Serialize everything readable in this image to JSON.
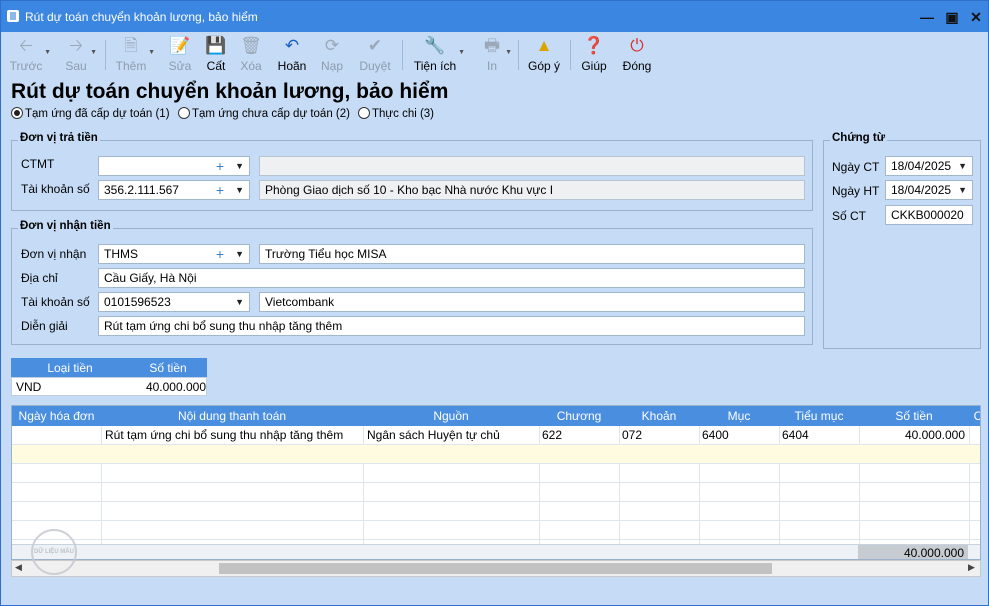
{
  "window": {
    "title": "Rút dự toán chuyển khoản lương, bảo hiểm"
  },
  "toolbar": {
    "items": [
      {
        "label": "Trước",
        "icon": "arrow-left-icon",
        "enabled": false
      },
      {
        "label": "Sau",
        "icon": "arrow-right-icon",
        "enabled": false
      },
      {
        "label": "Thêm",
        "icon": "new-document-icon",
        "enabled": false
      },
      {
        "label": "Sửa",
        "icon": "edit-document-icon",
        "enabled": false
      },
      {
        "label": "Cất",
        "icon": "save-icon",
        "enabled": true
      },
      {
        "label": "Xóa",
        "icon": "delete-document-icon",
        "enabled": false
      },
      {
        "label": "Hoãn",
        "icon": "undo-icon",
        "enabled": true
      },
      {
        "label": "Nạp",
        "icon": "refresh-icon",
        "enabled": false
      },
      {
        "label": "Duyệt",
        "icon": "checkmark-icon",
        "enabled": false
      },
      {
        "label": "Tiện ích",
        "icon": "tools-icon",
        "enabled": true
      },
      {
        "label": "In",
        "icon": "printer-icon",
        "enabled": false
      },
      {
        "label": "Góp ý",
        "icon": "feedback-icon",
        "enabled": true
      },
      {
        "label": "Giúp",
        "icon": "help-icon",
        "enabled": true
      },
      {
        "label": "Đóng",
        "icon": "power-icon",
        "enabled": true
      }
    ]
  },
  "page": {
    "heading": "Rút dự toán chuyển khoản lương, bảo hiểm"
  },
  "radio_options": [
    {
      "label": "Tạm ứng đã cấp dự toán (1)",
      "selected": true
    },
    {
      "label": "Tạm ứng chưa cấp dự toán (2)",
      "selected": false
    },
    {
      "label": "Thực chi (3)",
      "selected": false
    }
  ],
  "payer": {
    "legend": "Đơn vị trả tiền",
    "ctmt_label": "CTMT",
    "ctmt_value": "",
    "ctmt_desc": "",
    "account_label": "Tài khoản số",
    "account_value": "356.2.111.567",
    "account_desc": "Phòng Giao dịch số 10 - Kho bạc Nhà nước Khu vực I"
  },
  "payee": {
    "legend": "Đơn vị nhận tiền",
    "unit_label": "Đơn vị nhận",
    "unit_value": "THMS",
    "unit_desc": "Trường Tiểu học MISA",
    "address_label": "Địa chỉ",
    "address_value": "Cầu Giấy, Hà Nội",
    "account_label": "Tài khoản số",
    "account_value": "0101596523",
    "bank_value": "Vietcombank",
    "desc_label": "Diễn giải",
    "desc_value": "Rút tạm ứng chi bổ sung thu nhập tăng thêm"
  },
  "voucher": {
    "legend": "Chứng từ",
    "date_ct_label": "Ngày CT",
    "date_ct_value": "18/04/2025",
    "date_ht_label": "Ngày HT",
    "date_ht_value": "18/04/2025",
    "number_label": "Số CT",
    "number_value": "CKKB000020"
  },
  "currency": {
    "headers": [
      "Loại tiền",
      "Số tiền"
    ],
    "row": [
      "VND",
      "40.000.000"
    ]
  },
  "grid": {
    "headers": [
      "Ngày hóa đơn",
      "Nội dung thanh toán",
      "Nguồn",
      "Chương",
      "Khoản",
      "Mục",
      "Tiểu mục",
      "Số tiền",
      "C"
    ],
    "rows": [
      [
        "",
        "Rút tạm ứng chi bổ sung thu nhập tăng thêm",
        "Ngân sách Huyện tự chủ",
        "622",
        "072",
        "6400",
        "6404",
        "40.000.000"
      ]
    ],
    "total": "40.000.000"
  },
  "watermark": "DỮ LIỆU MẪU",
  "colors": {
    "titlebar": "#3b86e0",
    "window_bg": "#c6dcf6",
    "grid_header": "#4a8ee0",
    "selected_row": "#fffbe0"
  }
}
